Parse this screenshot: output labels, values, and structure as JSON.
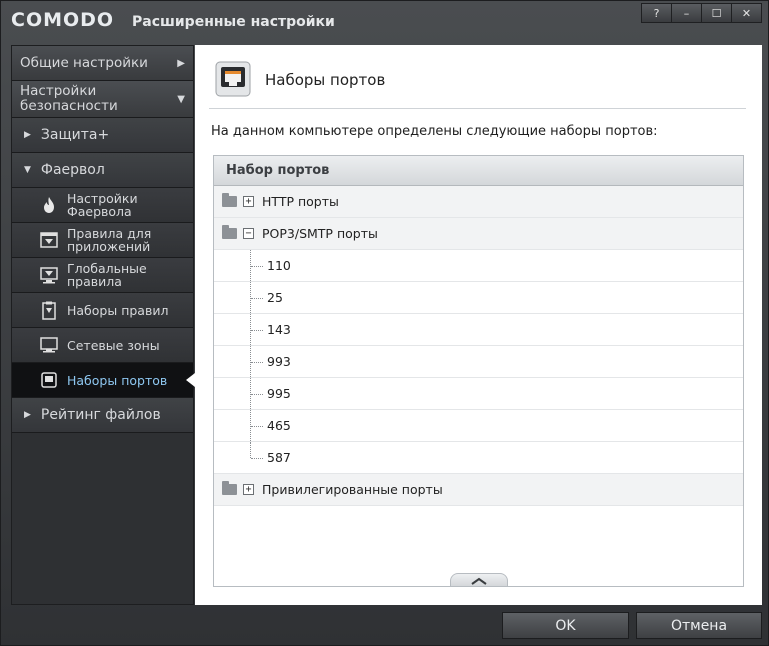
{
  "window": {
    "brand": "COMODO",
    "title": "Расширенные настройки",
    "controls": [
      "?",
      "–",
      "☐",
      "✕"
    ]
  },
  "sidebar": {
    "top": [
      {
        "label": "Общие настройки",
        "arrow": "▶"
      },
      {
        "label": "Настройки безопасности",
        "arrow": "▼"
      }
    ],
    "groups": {
      "protection": "Защита+",
      "firewall": "Фаервол",
      "file_rating": "Рейтинг файлов"
    },
    "firewall_items": [
      {
        "label": "Настройки Фаервола",
        "icon": "flame-icon"
      },
      {
        "label": "Правила для приложений",
        "icon": "app-rules-icon"
      },
      {
        "label": "Глобальные правила",
        "icon": "global-rules-icon"
      },
      {
        "label": "Наборы правил",
        "icon": "rulesets-icon"
      },
      {
        "label": "Сетевые зоны",
        "icon": "monitor-icon"
      },
      {
        "label": "Наборы портов",
        "icon": "port-icon",
        "active": true
      }
    ]
  },
  "main": {
    "title": "Наборы портов",
    "intro": "На данном компьютере определены следующие наборы портов:",
    "column_header": "Набор портов",
    "groups": [
      {
        "name": "HTTP порты",
        "expanded": false,
        "ports": []
      },
      {
        "name": "POP3/SMTP порты",
        "expanded": true,
        "ports": [
          "110",
          "25",
          "143",
          "993",
          "995",
          "465",
          "587"
        ]
      },
      {
        "name": "Привилегированные порты",
        "expanded": false,
        "ports": []
      }
    ],
    "expand_glyph": "+",
    "collapse_glyph": "−"
  },
  "buttons": {
    "ok": "OK",
    "cancel": "Отмена"
  }
}
